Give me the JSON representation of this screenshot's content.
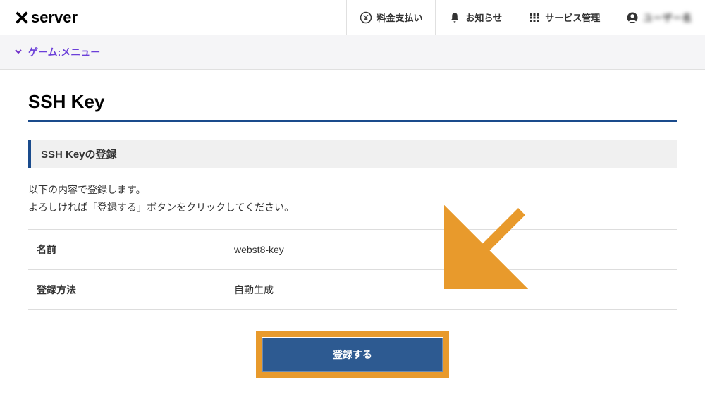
{
  "header": {
    "logo": "server",
    "nav": {
      "payment": "料金支払い",
      "notice": "お知らせ",
      "services": "サービス管理",
      "user": "ユーザー名"
    }
  },
  "submenu": {
    "label": "ゲーム:メニュー"
  },
  "page": {
    "title": "SSH Key",
    "section_title": "SSH Keyの登録",
    "description_line1": "以下の内容で登録します。",
    "description_line2": "よろしければ「登録する」ボタンをクリックしてください。"
  },
  "table": {
    "rows": [
      {
        "label": "名前",
        "value": "webst8-key"
      },
      {
        "label": "登録方法",
        "value": "自動生成"
      }
    ]
  },
  "action": {
    "submit": "登録する"
  }
}
